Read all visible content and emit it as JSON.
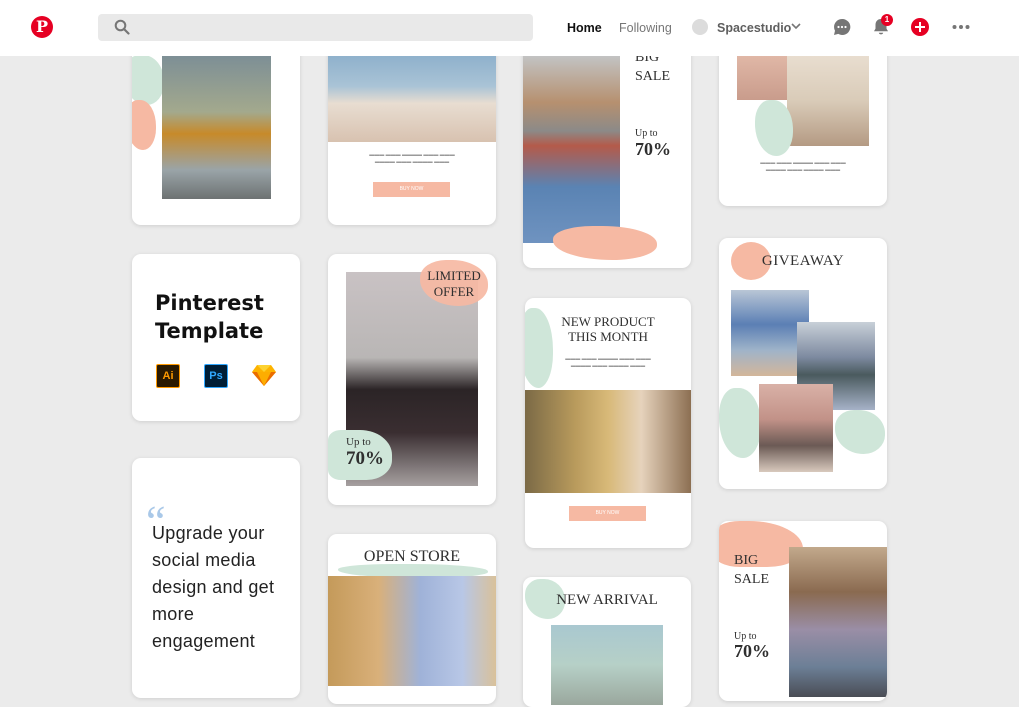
{
  "nav": {
    "home": "Home",
    "following": "Following",
    "profile_name": "Spacestudio",
    "notification_count": "1",
    "brand_color": "#e60023"
  },
  "cards": {
    "template": {
      "title_line1": "Pinterest",
      "title_line2": "Template",
      "apps": [
        "Ai",
        "Ps"
      ]
    },
    "quote": {
      "mark": "“",
      "text": "Upgrade your social media design and get more engagement"
    },
    "sale1": {
      "line1": "BIG",
      "line2": "SALE",
      "upto": "Up to",
      "pct": "70%"
    },
    "limited": {
      "line1": "LIMITED",
      "line2": "OFFER",
      "upto": "Up to",
      "pct": "70%"
    },
    "newproduct": {
      "line1": "NEW PRODUCT",
      "line2": "THIS MONTH",
      "button": "BUY NOW"
    },
    "giveaway": {
      "title": "GIVEAWAY"
    },
    "openstore": {
      "title": "OPEN STORE"
    },
    "newarrival": {
      "title": "NEW ARRIVAL"
    },
    "sale2": {
      "line1": "BIG",
      "line2": "SALE",
      "upto": "Up to",
      "pct": "70%"
    },
    "promo": {
      "button": "BUY NOW"
    }
  },
  "icons": [
    "pinterest-logo-icon",
    "search-icon",
    "chevron-down-icon",
    "chat-icon",
    "bell-icon",
    "add-icon",
    "more-icon",
    "illustrator-icon",
    "photoshop-icon",
    "sketch-icon"
  ],
  "colors": {
    "accent_pink": "#f6b9a3",
    "accent_mint": "#cfe6d9",
    "background": "#ebebeb"
  }
}
